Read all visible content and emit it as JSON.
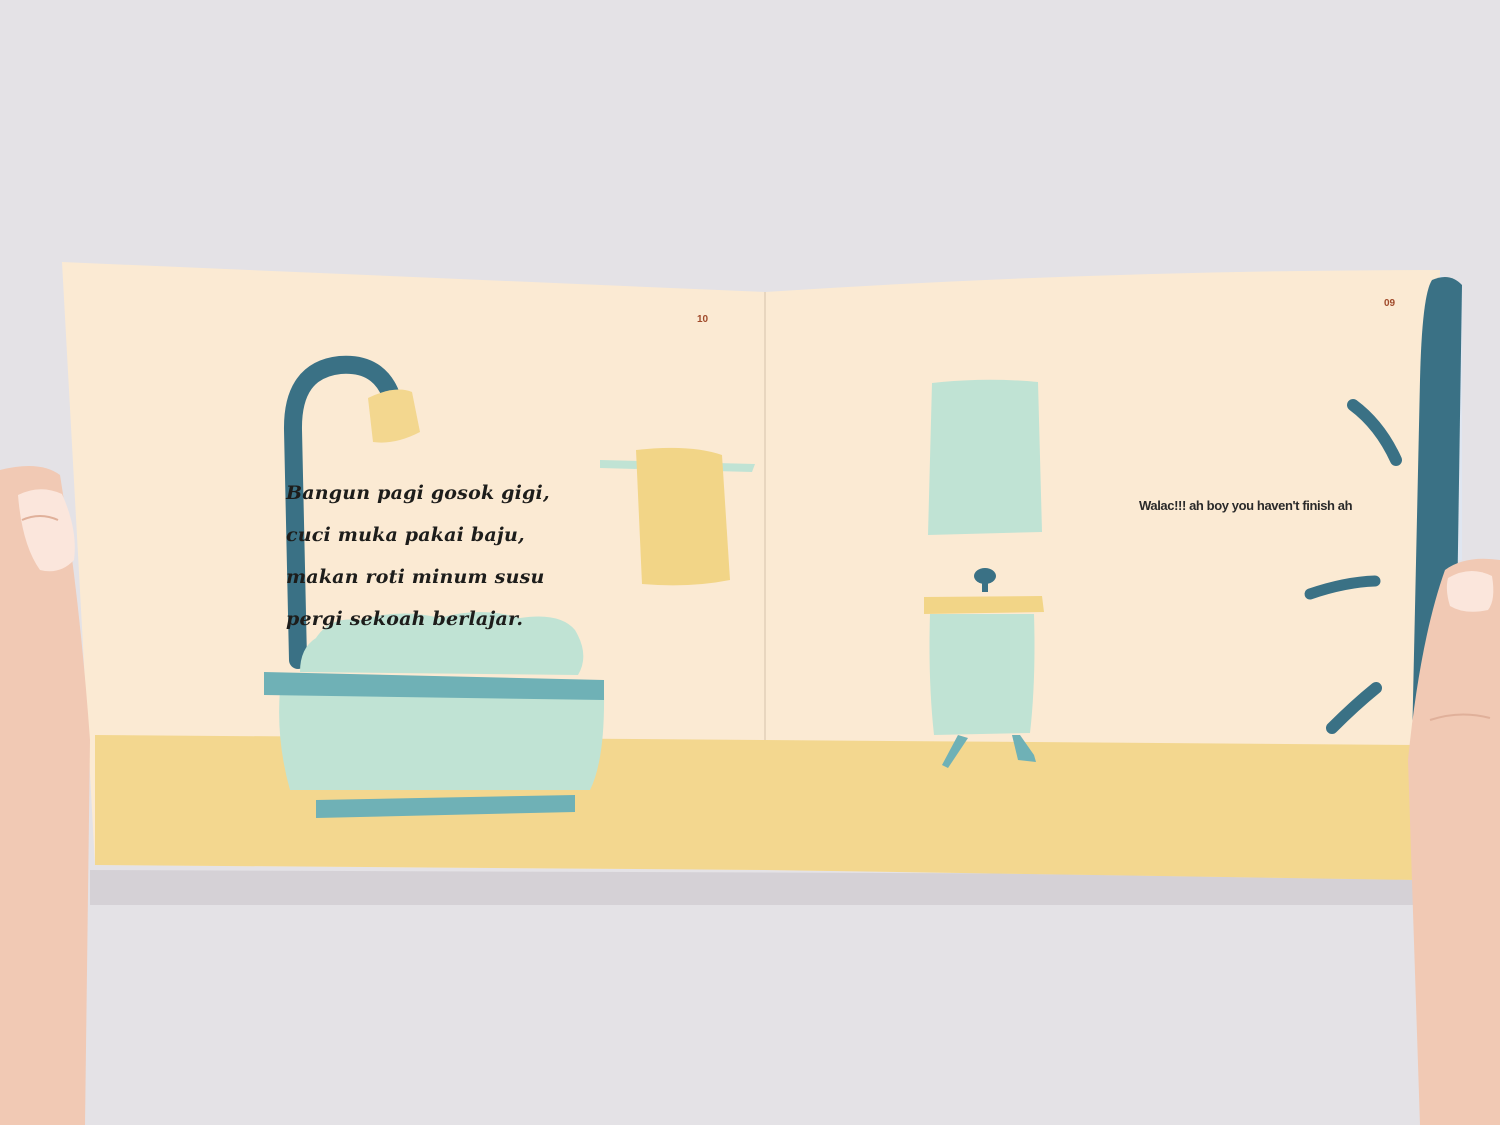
{
  "book": {
    "left_page": {
      "page_number": "10",
      "verse_lines": [
        "Bangun pagi gosok gigi,",
        "cuci muka pakai baju,",
        "makan roti minum susu",
        "pergi sekoah berlajar."
      ]
    },
    "right_page": {
      "page_number": "09",
      "speech": "Walac!!! ah boy you haven't finish ah"
    }
  },
  "colors": {
    "page": "#fbead3",
    "floor": "#f3d78f",
    "teal_dark": "#3a7185",
    "mint": "#c0e3d4",
    "teal_rim": "#6fb1b6",
    "yellow": "#f2d587",
    "background": "#e4e2e6",
    "skin": "#f1c9b4"
  },
  "icons": [
    "shower-icon",
    "bathtub-icon",
    "towel-icon",
    "mirror-icon",
    "sink-icon",
    "motion-line-icon"
  ]
}
